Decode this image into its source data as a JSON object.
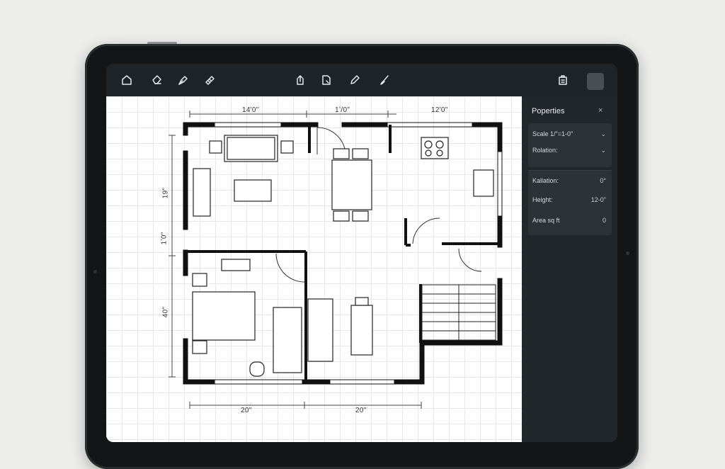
{
  "toolbar": {
    "left_tools": [
      "home-icon",
      "eraser-icon",
      "pen-tool-icon",
      "ruler-icon"
    ],
    "center_tools": [
      "share-icon",
      "document-icon",
      "pencil-icon",
      "brush-icon"
    ],
    "right_tools": [
      "clipboard-icon",
      "color-swatch"
    ]
  },
  "dimensions": {
    "top": [
      "14'0\"",
      "1ʼ/0\"",
      "12'0\""
    ],
    "left": [
      "19\"",
      "1ʼ0\"",
      "40\""
    ],
    "bottom": [
      "20\"",
      "20\""
    ]
  },
  "panel": {
    "title": "Poperties",
    "close": "×",
    "scale_label": "Scale 1/\"=1-0\"",
    "rotation_label": "Rolation:",
    "kallation_label": "Kallation:",
    "kallation_value": "0°",
    "height_label": "Height:",
    "height_value": "12-0\"",
    "area_label": "Area sq ft",
    "area_value": "0"
  }
}
